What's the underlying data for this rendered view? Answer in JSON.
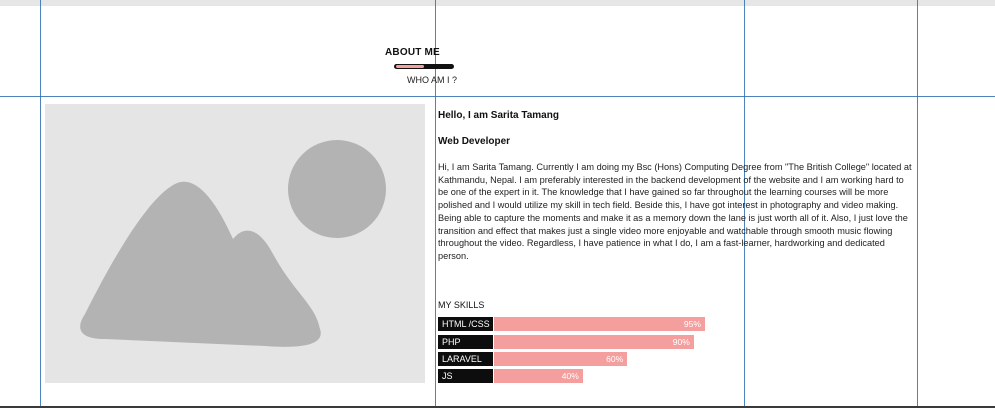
{
  "about": {
    "title": "ABOUT ME",
    "subtitle": "WHO AM I ?",
    "underline_progress": 0.5
  },
  "profile": {
    "greeting": "Hello, I am Sarita Tamang",
    "role": "Web Developer",
    "bio": "Hi, I am Sarita Tamang. Currently I am doing my Bsc (Hons) Computing Degree from \"The British College\" located at Kathmandu, Nepal. I am preferably interested in the backend development of the website and I am working hard to be one of the expert in it. The knowledge that I have gained so far throughout the learning courses will be more polished and I would utilize my skill in tech field. Beside this, I have got interest in photography and video making. Being able to capture the moments and make it as a memory down the lane is just worth all of it. Also, I just love the transition and effect that makes just a single video more enjoyable and watchable through smooth music flowing throughout the video. Regardless, I have patience in what I do, I am a fast-learner, hardworking and dedicated person."
  },
  "skills": {
    "title": "MY SKILLS",
    "items": [
      {
        "label": "HTML /CSS",
        "percent": "95%",
        "value": 95
      },
      {
        "label": "PHP",
        "percent": "90%",
        "value": 90
      },
      {
        "label": "LARAVEL",
        "percent": "60%",
        "value": 60
      },
      {
        "label": "JS",
        "percent": "40%",
        "value": 40
      }
    ]
  },
  "colors": {
    "guide_lines": "#2f6fb3",
    "skill_bar": "#f59e9e",
    "label_bg": "#0d0d0d",
    "placeholder_bg": "#e5e5e5",
    "placeholder_shape": "#b3b3b3"
  },
  "icons": {
    "image_placeholder": "image-placeholder-icon"
  }
}
